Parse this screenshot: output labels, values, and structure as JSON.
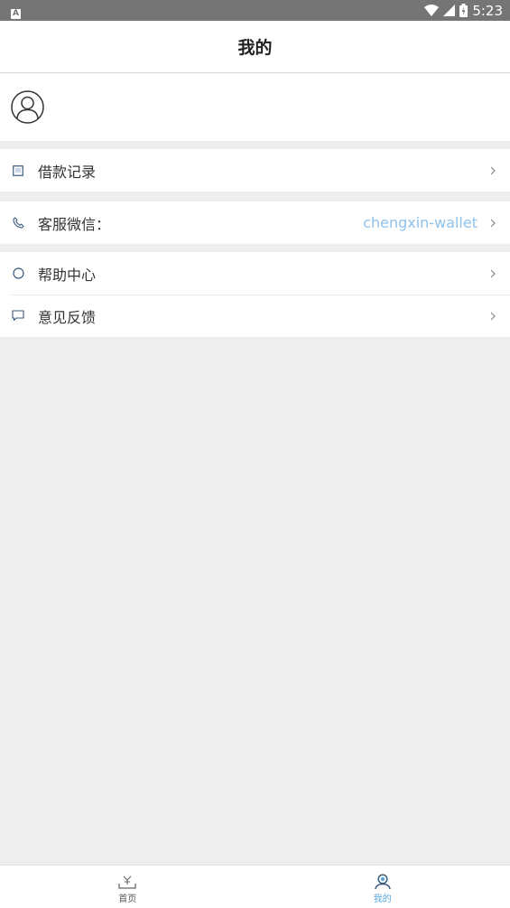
{
  "status_bar": {
    "left_badge": "A",
    "time": "5:23"
  },
  "header": {
    "title": "我的"
  },
  "menu": {
    "loan_records": {
      "label": "借款记录",
      "icon": "document-icon"
    },
    "customer_service": {
      "label": "客服微信：",
      "value": "chengxin-wallet",
      "icon": "phone-icon"
    },
    "help_center": {
      "label": "帮助中心",
      "icon": "circle-icon"
    },
    "feedback": {
      "label": "意见反馈",
      "icon": "chat-icon"
    }
  },
  "tabbar": {
    "home": {
      "label": "首页",
      "icon": "home-icon"
    },
    "mine": {
      "label": "我的",
      "icon": "user-icon",
      "active": true
    }
  },
  "colors": {
    "accent": "#8fc2ec",
    "tab_active": "#5aa6e0",
    "background": "#eeeeee",
    "status_bar": "#757575"
  }
}
